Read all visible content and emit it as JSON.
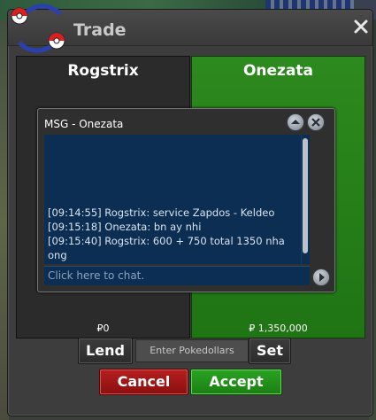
{
  "window": {
    "title": "Trade"
  },
  "players": {
    "left": {
      "name": "Rogstrix",
      "amount": "₽0"
    },
    "right": {
      "name": "Onezata",
      "amount": "₽ 1,350,000"
    }
  },
  "chat": {
    "title": "MSG - Onezata",
    "lines": [
      "[09:14:55] Rogstrix: service Zapdos - Keldeo",
      "[09:15:18] Onezata: bn ay nhi",
      "[09:15:40] Rogstrix: 600 + 750 total 1350 nha",
      "ong"
    ],
    "input_placeholder": "Click here to chat."
  },
  "controls": {
    "lend_label": "Lend",
    "pokedollars_placeholder": "Enter Pokedollars",
    "set_label": "Set",
    "cancel_label": "Cancel",
    "accept_label": "Accept"
  },
  "icons": {
    "logo": "pokeball-trade-logo-icon",
    "close": "close-icon",
    "chat_up": "chevron-up-icon",
    "chat_close": "close-icon",
    "chat_send": "arrow-right-icon"
  },
  "colors": {
    "accept_green": "#2aa322",
    "cancel_red": "#b61f1f",
    "chat_bg": "#0b2e52",
    "offer_panel_green": "#2d8a1e"
  }
}
